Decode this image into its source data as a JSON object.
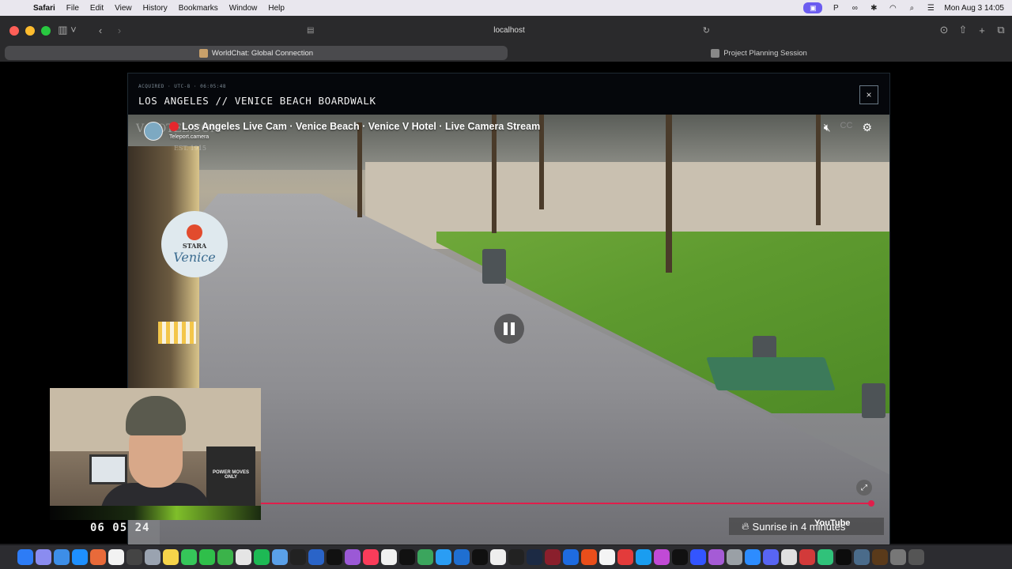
{
  "menubar": {
    "app": "Safari",
    "items": [
      "File",
      "Edit",
      "View",
      "History",
      "Bookmarks",
      "Window",
      "Help"
    ],
    "clock": "Mon Aug 3  14:05"
  },
  "browser": {
    "url": "localhost",
    "tabs": [
      {
        "label": "WorldChat: Global Connection",
        "active": true
      },
      {
        "label": "Project Planning Session",
        "active": false
      }
    ]
  },
  "panel": {
    "meta": "ACQUIRED · UTC-8 · 06:05:48",
    "location": "LOS ANGELES // VENICE BEACH BOARDWALK",
    "close_icon": "×"
  },
  "video": {
    "title": "Los Angeles Live Cam · Venice Beach · Venice V Hotel · Live Camera Stream",
    "channel": "Teleport.camera",
    "watermark": "V HOTEL.COM",
    "watermark_est": "EST. 1915",
    "sign_small": "STARA",
    "sign_big": "Venice",
    "sunrise_text": "Sunrise in 4 minutes",
    "youtube_logo": "YouTube",
    "progress": 1.0
  },
  "webcam": {
    "poster": "POWER MOVES ONLY",
    "timestamp": "06 05 24"
  },
  "colors": {
    "accent_progress": "#e01e4b",
    "live_dot": "#e5272d",
    "panel_bg": "#05070b"
  }
}
